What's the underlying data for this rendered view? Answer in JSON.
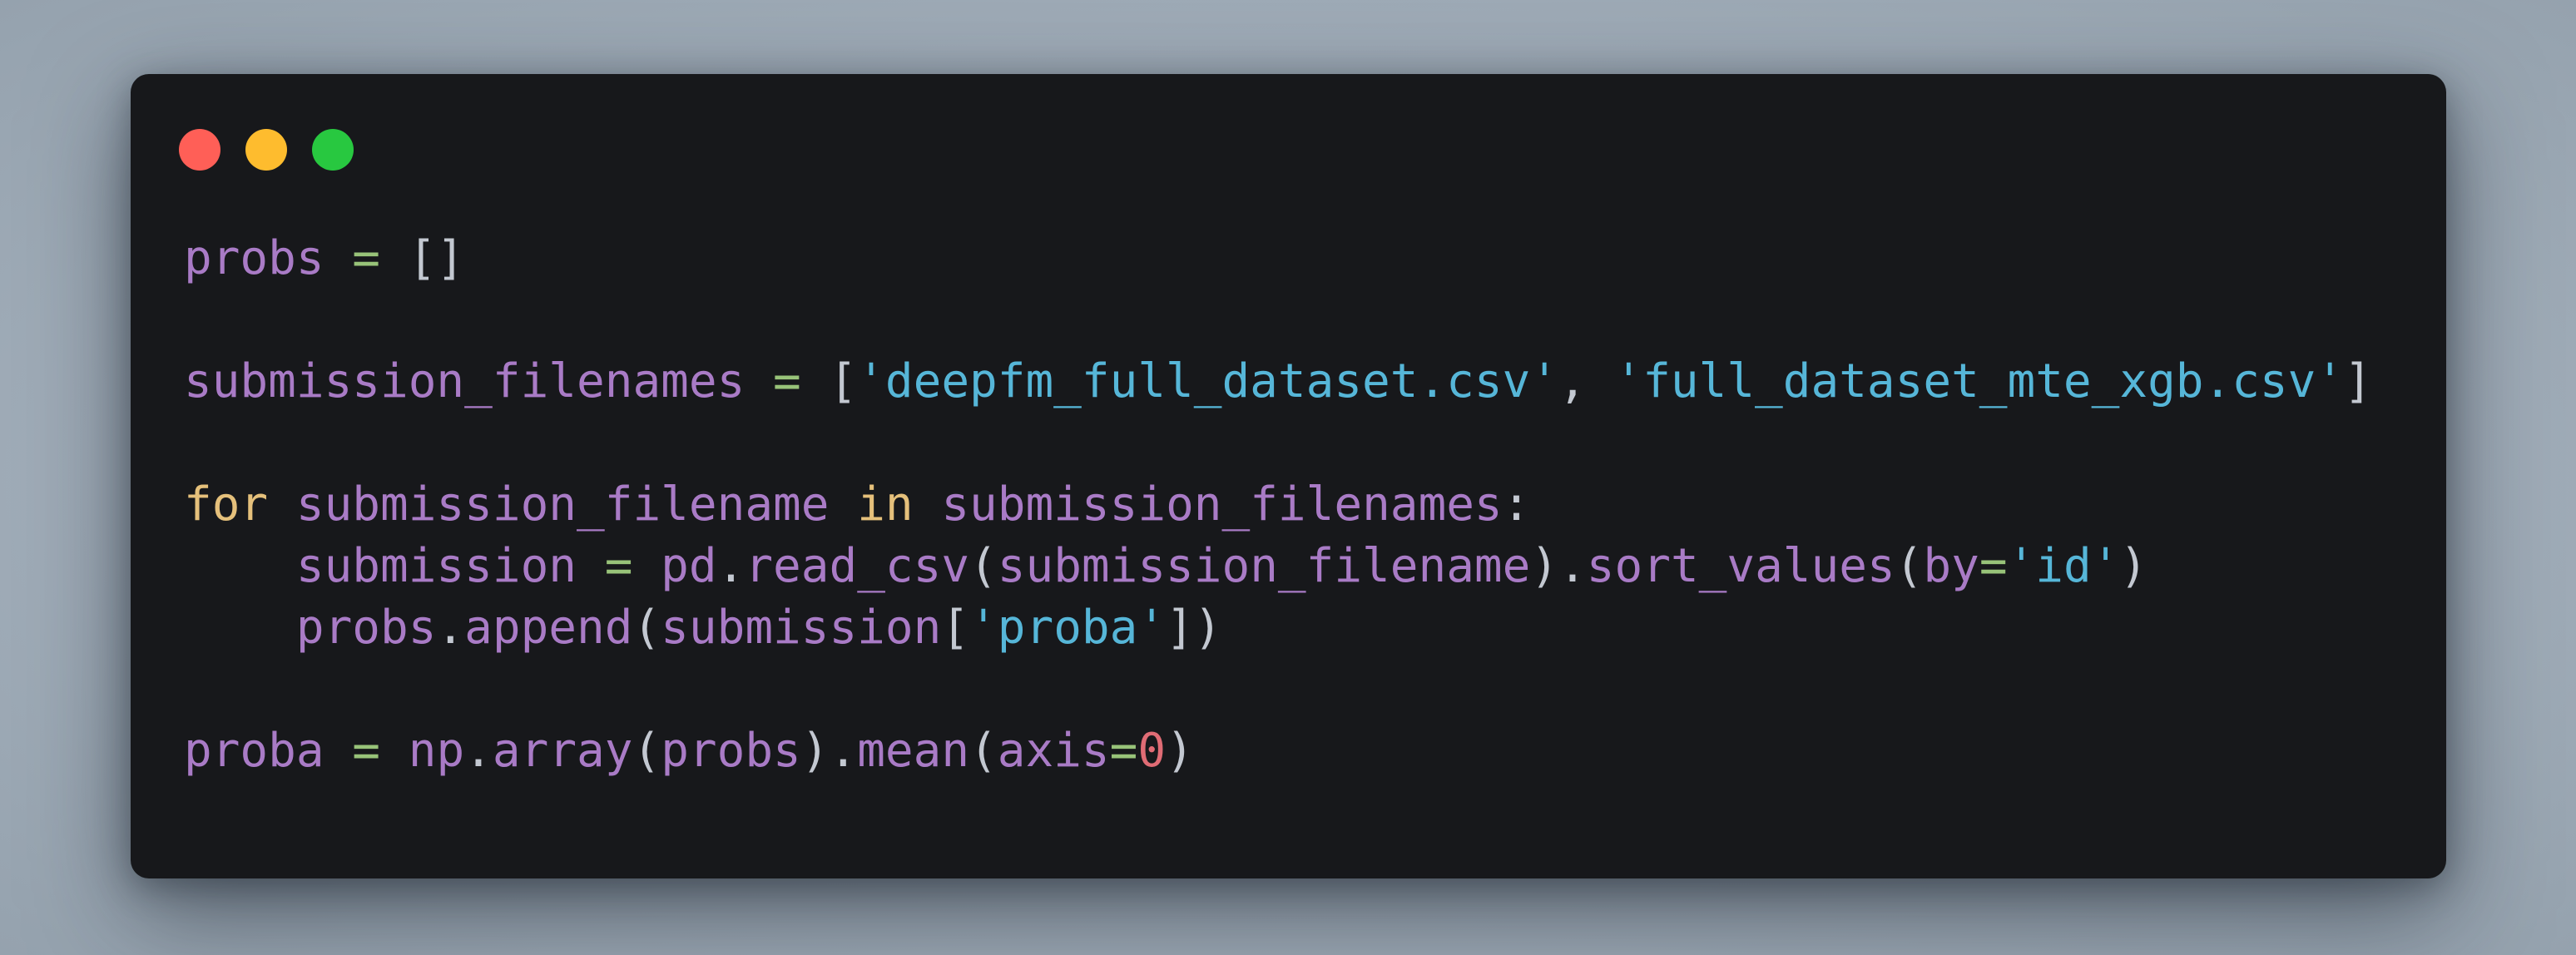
{
  "colors": {
    "background": "#a3afbb",
    "window": "#17181b",
    "close": "#ff5f57",
    "minimize": "#febc2e",
    "maximize": "#28c840",
    "variable": "#a97bc6",
    "operator": "#98c379",
    "punctuation": "#c3c8d1",
    "string": "#56b6d8",
    "keyword": "#e5c07b",
    "number": "#e06c75"
  },
  "window_controls": {
    "close_icon": "close-icon",
    "minimize_icon": "minimize-icon",
    "maximize_icon": "maximize-icon"
  },
  "code": {
    "language": "python",
    "lines": [
      [
        {
          "t": "probs",
          "k": "var"
        },
        {
          "t": " ",
          "k": "pun"
        },
        {
          "t": "=",
          "k": "op"
        },
        {
          "t": " ",
          "k": "pun"
        },
        {
          "t": "[]",
          "k": "pun"
        }
      ],
      [],
      [
        {
          "t": "submission_filenames",
          "k": "var"
        },
        {
          "t": " ",
          "k": "pun"
        },
        {
          "t": "=",
          "k": "op"
        },
        {
          "t": " [",
          "k": "pun"
        },
        {
          "t": "'deepfm_full_dataset.csv'",
          "k": "str"
        },
        {
          "t": ", ",
          "k": "pun"
        },
        {
          "t": "'full_dataset_mte_xgb.csv'",
          "k": "str"
        },
        {
          "t": "]",
          "k": "pun"
        }
      ],
      [],
      [
        {
          "t": "for",
          "k": "kw"
        },
        {
          "t": " ",
          "k": "pun"
        },
        {
          "t": "submission_filename",
          "k": "var"
        },
        {
          "t": " ",
          "k": "pun"
        },
        {
          "t": "in",
          "k": "kw"
        },
        {
          "t": " ",
          "k": "pun"
        },
        {
          "t": "submission_filenames",
          "k": "var"
        },
        {
          "t": ":",
          "k": "pun"
        }
      ],
      [
        {
          "t": "    ",
          "k": "pun"
        },
        {
          "t": "submission",
          "k": "var"
        },
        {
          "t": " ",
          "k": "pun"
        },
        {
          "t": "=",
          "k": "op"
        },
        {
          "t": " ",
          "k": "pun"
        },
        {
          "t": "pd",
          "k": "var"
        },
        {
          "t": ".",
          "k": "pun"
        },
        {
          "t": "read_csv",
          "k": "var"
        },
        {
          "t": "(",
          "k": "pun"
        },
        {
          "t": "submission_filename",
          "k": "var"
        },
        {
          "t": ").",
          "k": "pun"
        },
        {
          "t": "sort_values",
          "k": "var"
        },
        {
          "t": "(",
          "k": "pun"
        },
        {
          "t": "by",
          "k": "var"
        },
        {
          "t": "=",
          "k": "op"
        },
        {
          "t": "'id'",
          "k": "str"
        },
        {
          "t": ")",
          "k": "pun"
        }
      ],
      [
        {
          "t": "    ",
          "k": "pun"
        },
        {
          "t": "probs",
          "k": "var"
        },
        {
          "t": ".",
          "k": "pun"
        },
        {
          "t": "append",
          "k": "var"
        },
        {
          "t": "(",
          "k": "pun"
        },
        {
          "t": "submission",
          "k": "var"
        },
        {
          "t": "[",
          "k": "pun"
        },
        {
          "t": "'proba'",
          "k": "str"
        },
        {
          "t": "])",
          "k": "pun"
        }
      ],
      [],
      [
        {
          "t": "proba",
          "k": "var"
        },
        {
          "t": " ",
          "k": "pun"
        },
        {
          "t": "=",
          "k": "op"
        },
        {
          "t": " ",
          "k": "pun"
        },
        {
          "t": "np",
          "k": "var"
        },
        {
          "t": ".",
          "k": "pun"
        },
        {
          "t": "array",
          "k": "var"
        },
        {
          "t": "(",
          "k": "pun"
        },
        {
          "t": "probs",
          "k": "var"
        },
        {
          "t": ").",
          "k": "pun"
        },
        {
          "t": "mean",
          "k": "var"
        },
        {
          "t": "(",
          "k": "pun"
        },
        {
          "t": "axis",
          "k": "var"
        },
        {
          "t": "=",
          "k": "op"
        },
        {
          "t": "0",
          "k": "num"
        },
        {
          "t": ")",
          "k": "pun"
        }
      ]
    ]
  }
}
